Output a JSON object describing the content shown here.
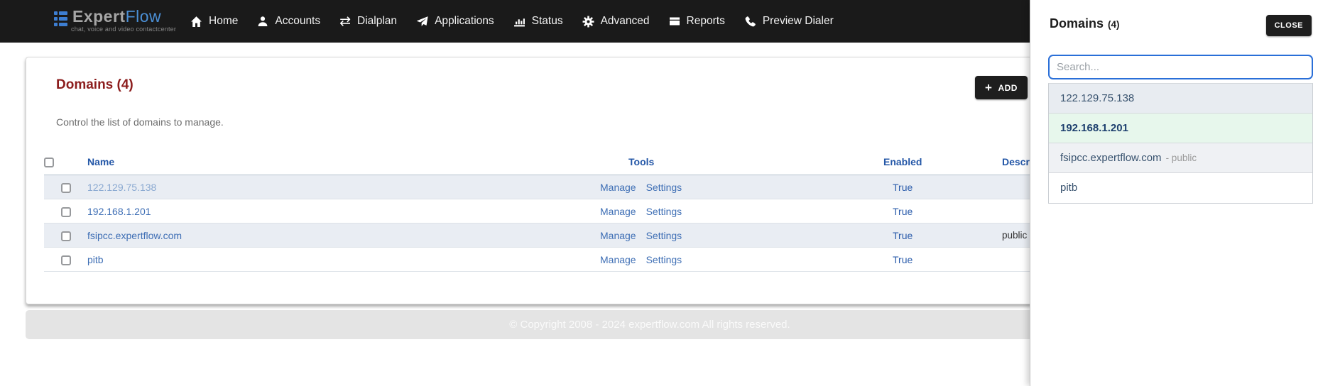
{
  "navbar": {
    "logo": {
      "expert": "Expert",
      "flow": "Flow",
      "tagline": "chat, voice and video contactcenter"
    },
    "items": [
      {
        "icon": "home-icon",
        "label": "Home"
      },
      {
        "icon": "accounts-icon",
        "label": "Accounts"
      },
      {
        "icon": "dialplan-icon",
        "label": "Dialplan",
        "glyph": "⇄"
      },
      {
        "icon": "applications-icon",
        "label": "Applications"
      },
      {
        "icon": "status-icon",
        "label": "Status"
      },
      {
        "icon": "advanced-icon",
        "label": "Advanced"
      },
      {
        "icon": "reports-icon",
        "label": "Reports"
      },
      {
        "icon": "preview-dialer-icon",
        "label": "Preview Dialer"
      }
    ]
  },
  "main": {
    "heading": "Domains (4)",
    "add_plus": "+",
    "add_label": "ADD",
    "description": "Control the list of domains to manage.",
    "table": {
      "headers": {
        "name": "Name",
        "tools": "Tools",
        "enabled": "Enabled",
        "description": "Description"
      },
      "rows": [
        {
          "name": "122.129.75.138",
          "manage": "Manage",
          "settings": "Settings",
          "enabled": "True",
          "description": ""
        },
        {
          "name": "192.168.1.201",
          "manage": "Manage",
          "settings": "Settings",
          "enabled": "True",
          "description": ""
        },
        {
          "name": "fsipcc.expertflow.com",
          "manage": "Manage",
          "settings": "Settings",
          "enabled": "True",
          "description": "public"
        },
        {
          "name": "pitb",
          "manage": "Manage",
          "settings": "Settings",
          "enabled": "True",
          "description": ""
        }
      ]
    },
    "footer": "© Copyright 2008 - 2024 expertflow.com All rights reserved."
  },
  "panel": {
    "title": "Domains",
    "count": "(4)",
    "close_label": "CLOSE",
    "search_placeholder": "Search...",
    "items": [
      {
        "label": "122.129.75.138",
        "suffix": ""
      },
      {
        "label": "192.168.1.201",
        "suffix": ""
      },
      {
        "label": "fsipcc.expertflow.com",
        "suffix": "- public"
      },
      {
        "label": "pitb",
        "suffix": ""
      }
    ]
  },
  "colors": {
    "navbar_bg": "#1a1a1a",
    "brand_blue": "#4b8fd5",
    "heading_red": "#8c1d1d",
    "header_blue": "#2457a7",
    "link_blue": "#3f6fb5",
    "selected_green_bg": "#e7f7ec",
    "stripe_bg": "#e9edf3",
    "search_border": "#2a6fd8"
  }
}
